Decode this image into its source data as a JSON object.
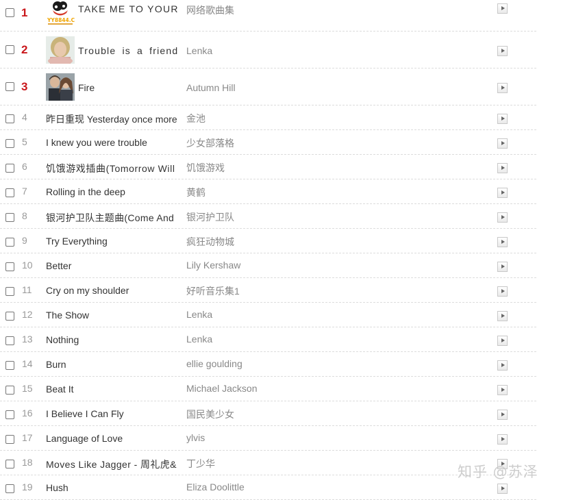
{
  "songs": [
    {
      "rank": "1",
      "title": "TAKE ME TO YOUR",
      "artist": "网络歌曲集",
      "cover": "yy8844-logo",
      "cover_text": "YY8844.CN"
    },
    {
      "rank": "2",
      "title": "Trouble is a friend -",
      "artist": "Lenka",
      "cover": "lenka-portrait"
    },
    {
      "rank": "3",
      "title": "Fire",
      "artist": "Autumn Hill",
      "cover": "duo-portrait"
    },
    {
      "rank": "4",
      "title": "昨日重现 Yesterday once more",
      "artist": "金池"
    },
    {
      "rank": "5",
      "title": "I knew you were trouble",
      "artist": "少女部落格"
    },
    {
      "rank": "6",
      "title": "饥饿游戏插曲(Tomorrow Will",
      "artist": "饥饿游戏"
    },
    {
      "rank": "7",
      "title": "Rolling in the deep",
      "artist": "黄鹤"
    },
    {
      "rank": "8",
      "title": "银河护卫队主题曲(Come And",
      "artist": "银河护卫队"
    },
    {
      "rank": "9",
      "title": "Try Everything",
      "artist": "疯狂动物城"
    },
    {
      "rank": "10",
      "title": "Better",
      "artist": "Lily Kershaw"
    },
    {
      "rank": "11",
      "title": "Cry on my shoulder",
      "artist": "好听音乐集1"
    },
    {
      "rank": "12",
      "title": "The Show",
      "artist": "Lenka"
    },
    {
      "rank": "13",
      "title": "Nothing",
      "artist": "Lenka"
    },
    {
      "rank": "14",
      "title": "Burn",
      "artist": "ellie goulding"
    },
    {
      "rank": "15",
      "title": "Beat It",
      "artist": "Michael Jackson"
    },
    {
      "rank": "16",
      "title": "I Believe I Can Fly",
      "artist": "国民美少女"
    },
    {
      "rank": "17",
      "title": "Language of Love",
      "artist": "ylvis"
    },
    {
      "rank": "18",
      "title": "Moves Like Jagger - 周礼虎&",
      "artist": "丁少华"
    },
    {
      "rank": "19",
      "title": "Hush",
      "artist": "Eliza Doolittle"
    }
  ],
  "icons": {
    "checkbox": "checkbox-icon",
    "play": "play-icon"
  },
  "colors": {
    "top_rank": "#c9171b",
    "rank": "#999999",
    "artist": "#888888",
    "title": "#333333"
  },
  "watermark": "知乎 @苏泽"
}
